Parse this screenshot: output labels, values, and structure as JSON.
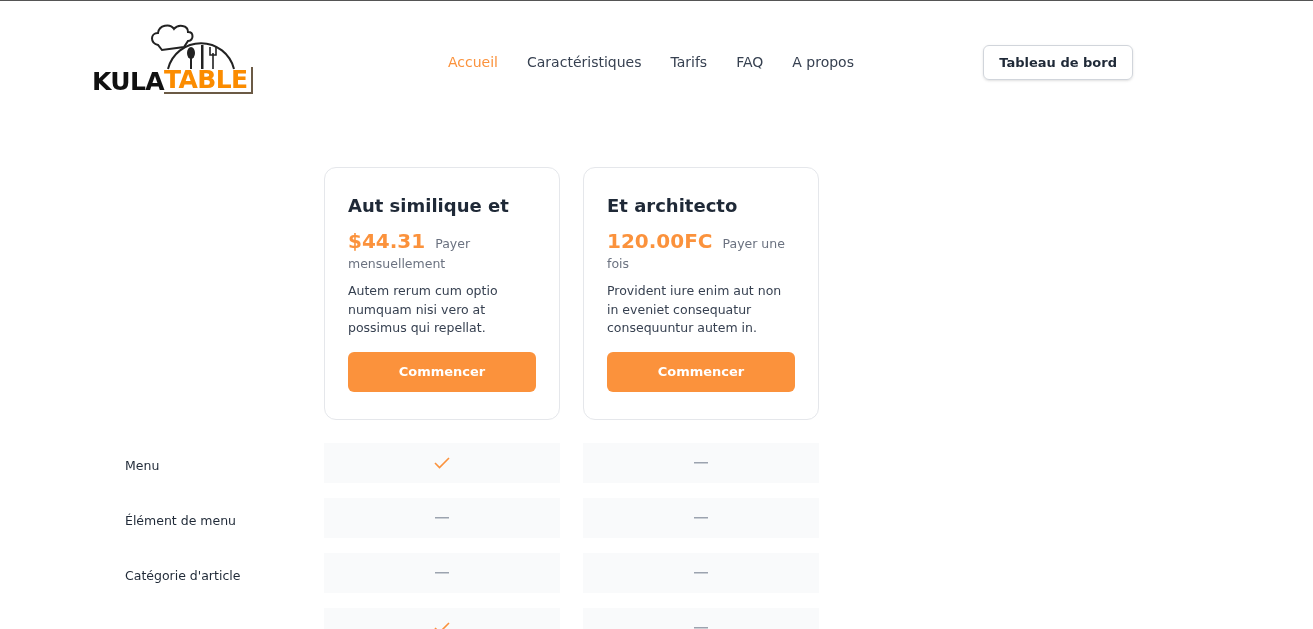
{
  "logo": {
    "dark_part": "KULA",
    "accent_part": "TABLE"
  },
  "nav": [
    {
      "label": "Accueil",
      "selected": true
    },
    {
      "label": "Caractéristiques",
      "selected": false
    },
    {
      "label": "Tarifs",
      "selected": false
    },
    {
      "label": "FAQ",
      "selected": false
    },
    {
      "label": "A propos",
      "selected": false
    }
  ],
  "dashboard_button": "Tableau de bord",
  "plans": [
    {
      "name": "Aut similique et",
      "price": "$44.31",
      "period": "Payer mensuellement",
      "description": "Autem rerum cum optio numquam nisi vero at possimus qui repellat.",
      "button": "Commencer"
    },
    {
      "name": "Et architecto",
      "price": "120.00FC",
      "period": "Payer une fois",
      "description": "Provident iure enim aut non in eveniet consequatur consequuntur autem in.",
      "button": "Commencer"
    }
  ],
  "features": [
    {
      "label": "Menu",
      "included": [
        true,
        false
      ]
    },
    {
      "label": "Élément de menu",
      "included": [
        false,
        false
      ]
    },
    {
      "label": "Catégorie d'article",
      "included": [
        false,
        false
      ]
    },
    {
      "included": [
        true,
        false
      ]
    }
  ]
}
